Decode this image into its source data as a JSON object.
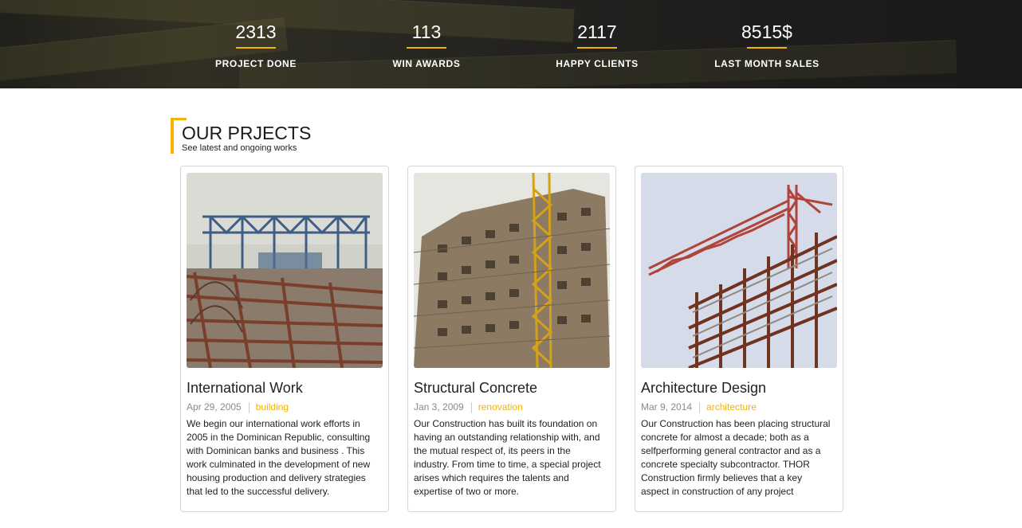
{
  "stats": [
    {
      "value": "2313",
      "label": "PROJECT DONE"
    },
    {
      "value": "113",
      "label": "WIN AWARDS"
    },
    {
      "value": "2117",
      "label": "HAPPY CLIENTS"
    },
    {
      "value": "8515$",
      "label": "LAST MONTH SALES"
    }
  ],
  "colors": {
    "accent": "#f5b300",
    "text": "#222222",
    "muted": "#8a8a8a",
    "border": "#d6d6d6"
  },
  "projects_section": {
    "title": "OUR PRJECTS",
    "subtitle": "See latest and ongoing works"
  },
  "projects": [
    {
      "title": "International Work",
      "date": "Apr 29, 2005",
      "category": "building",
      "text": "We begin our international work efforts in 2005 in the Dominican Republic, consulting with Dominican banks and business . This work culminated in the development of new housing production and delivery strategies that led to the successful delivery.",
      "image": "steel-frame-construction-site"
    },
    {
      "title": "Structural Concrete",
      "date": "Jan 3, 2009",
      "category": "renovation",
      "text": "Our Construction has built its foundation on having an outstanding relationship with, and the mutual respect of, its peers in the industry. From time to time, a special project arises which requires the talents and expertise of two or more.",
      "image": "concrete-tower-with-crane"
    },
    {
      "title": "Architecture Design",
      "date": "Mar 9, 2014",
      "category": "architecture",
      "text": "Our Construction has been placing structural concrete for almost a decade; both as a selfperforming general contractor and as a concrete specialty subcontractor. THOR Construction firmly believes that a key aspect in construction of any project",
      "image": "steel-building-with-tower-crane"
    }
  ]
}
